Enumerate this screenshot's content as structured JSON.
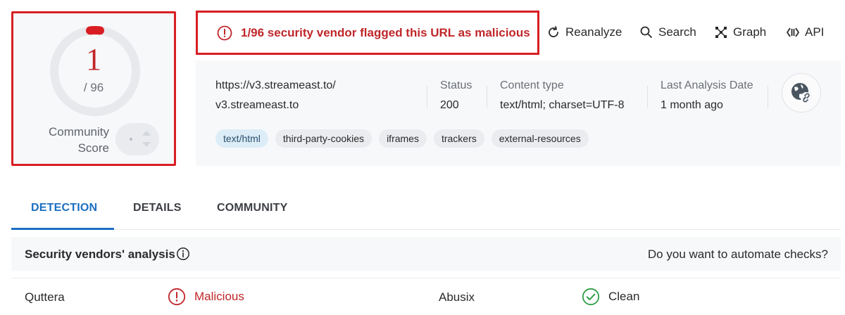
{
  "score": {
    "value": "1",
    "total": "/ 96",
    "community_label_line1": "Community",
    "community_label_line2": "Score"
  },
  "alert": {
    "text": "1/96 security vendor flagged this URL as malicious",
    "color": "#c0262a"
  },
  "actions": [
    {
      "label": "Reanalyze",
      "icon": "refresh-icon"
    },
    {
      "label": "Search",
      "icon": "search-icon"
    },
    {
      "label": "Graph",
      "icon": "graph-icon"
    },
    {
      "label": "API",
      "icon": "api-icon"
    }
  ],
  "info": {
    "url_line1": "https://v3.streameast.to/",
    "url_line2": "v3.streameast.to",
    "status_label": "Status",
    "status_value": "200",
    "content_type_label": "Content type",
    "content_type_value": "text/html; charset=UTF-8",
    "last_analysis_label": "Last Analysis Date",
    "last_analysis_value": "1 month ago",
    "tags": [
      "text/html",
      "third-party-cookies",
      "iframes",
      "trackers",
      "external-resources"
    ]
  },
  "tabs": [
    {
      "label": "DETECTION",
      "active": true
    },
    {
      "label": "DETAILS",
      "active": false
    },
    {
      "label": "COMMUNITY",
      "active": false
    }
  ],
  "analysis": {
    "title": "Security vendors' analysis",
    "automate": "Do you want to automate checks?"
  },
  "vendors": [
    {
      "name": "Quttera",
      "verdict": "Malicious",
      "verdict_color": "#c0262a",
      "verdict_icon": "alert-circle-icon"
    },
    {
      "name": "Abusix",
      "verdict": "Clean",
      "verdict_color": "#2a2a2a",
      "verdict_icon": "check-circle-icon"
    }
  ],
  "colors": {
    "accent": "#1c6fc2",
    "danger": "#d81e23",
    "clean": "#2e9e44"
  }
}
